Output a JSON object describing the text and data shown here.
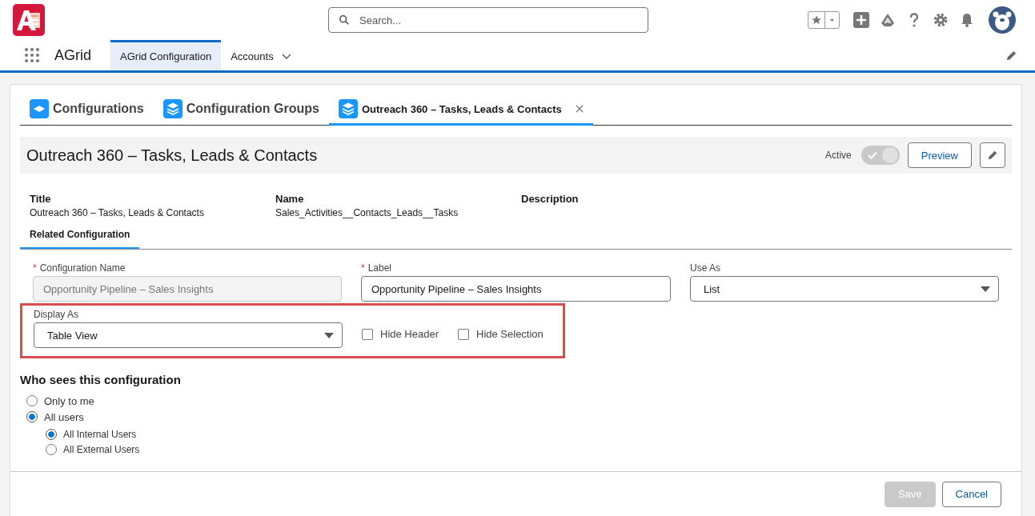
{
  "app": {
    "name": "AGrid"
  },
  "search": {
    "placeholder": "Search..."
  },
  "nav_tabs": [
    {
      "label": "AGrid Configuration",
      "selected": true,
      "dropdown": false
    },
    {
      "label": "Accounts",
      "selected": false,
      "dropdown": true
    }
  ],
  "sub_tabs": [
    {
      "label": "Configurations",
      "selected": false,
      "kind": "single",
      "closable": false
    },
    {
      "label": "Configuration Groups",
      "selected": false,
      "kind": "stack",
      "closable": false
    },
    {
      "label": "Outreach 360 – Tasks, Leads & Contacts",
      "selected": true,
      "kind": "stack",
      "closable": true
    }
  ],
  "record": {
    "title": "Outreach 360 – Tasks, Leads & Contacts",
    "active_label": "Active",
    "active": true,
    "preview": "Preview"
  },
  "details": [
    {
      "label": "Title",
      "value": "Outreach 360 – Tasks, Leads & Contacts"
    },
    {
      "label": "Name",
      "value": "Sales_Activities__Contacts_Leads__Tasks"
    },
    {
      "label": "Description"
    }
  ],
  "section_tabs": [
    {
      "label": "Related Configuration",
      "selected": true
    }
  ],
  "fields": [
    {
      "label": "Configuration Name",
      "required_mark": "*",
      "kind": "text",
      "value": "Opportunity Pipeline – Sales Insights",
      "disabled": true
    },
    {
      "label": "Label",
      "required_mark": "*",
      "kind": "text",
      "value": "Opportunity Pipeline – Sales Insights",
      "disabled": false
    },
    {
      "label": "Use As",
      "kind": "select",
      "value": "List",
      "disabled": false
    }
  ],
  "display": {
    "label": "Display As",
    "value": "Table View",
    "highlighted": true,
    "checkboxes": [
      {
        "label": "Hide Header",
        "checked": false
      },
      {
        "label": "Hide Selection",
        "checked": false
      }
    ]
  },
  "visibility": {
    "title": "Who sees this configuration",
    "options": [
      {
        "label": "Only to me",
        "selected": false
      },
      {
        "label": "All users",
        "selected": true,
        "children": [
          {
            "label": "All Internal Users",
            "selected": true
          },
          {
            "label": "All External Users",
            "selected": false
          }
        ]
      }
    ]
  },
  "footer": {
    "buttons": [
      {
        "label": "Save",
        "disabled": true
      },
      {
        "label": "Cancel",
        "disabled": false
      }
    ]
  }
}
